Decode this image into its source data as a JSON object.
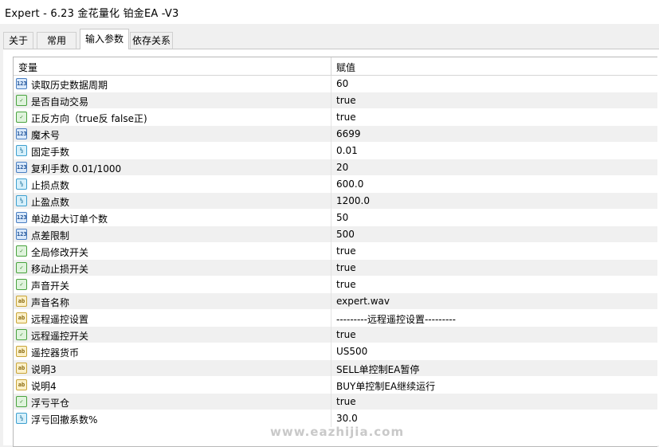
{
  "window": {
    "title": "Expert - 6.23  金花量化 铂金EA  -V3"
  },
  "tabs": [
    {
      "label": "关于"
    },
    {
      "label": "常用"
    },
    {
      "label": "输入参数"
    },
    {
      "label": "依存关系"
    }
  ],
  "table": {
    "header": {
      "variable": "变量",
      "value": "赋值"
    },
    "rows": [
      {
        "type": "int-icon",
        "icon_text": "123",
        "name": "读取历史数据周期",
        "value": "60"
      },
      {
        "type": "bool-icon",
        "icon_text": "✓",
        "name": "是否自动交易",
        "value": "true"
      },
      {
        "type": "bool-icon",
        "icon_text": "✓",
        "name": "正反方向（true反 false正)",
        "value": "true"
      },
      {
        "type": "int-icon",
        "icon_text": "123",
        "name": "魔术号",
        "value": "6699"
      },
      {
        "type": "double-icon",
        "icon_text": "½",
        "name": "固定手数",
        "value": "0.01"
      },
      {
        "type": "int-icon",
        "icon_text": "123",
        "name": "复利手数 0.01/1000",
        "value": "20"
      },
      {
        "type": "double-icon",
        "icon_text": "½",
        "name": "止损点数",
        "value": "600.0"
      },
      {
        "type": "double-icon",
        "icon_text": "½",
        "name": "止盈点数",
        "value": "1200.0"
      },
      {
        "type": "int-icon",
        "icon_text": "123",
        "name": "单边最大订单个数",
        "value": "50"
      },
      {
        "type": "int-icon",
        "icon_text": "123",
        "name": "点差限制",
        "value": "500"
      },
      {
        "type": "bool-icon",
        "icon_text": "✓",
        "name": "全局修改开关",
        "value": "true"
      },
      {
        "type": "bool-icon",
        "icon_text": "✓",
        "name": "移动止损开关",
        "value": "true"
      },
      {
        "type": "bool-icon",
        "icon_text": "✓",
        "name": "声音开关",
        "value": "true"
      },
      {
        "type": "string-icon",
        "icon_text": "ab",
        "name": "声音名称",
        "value": "expert.wav"
      },
      {
        "type": "string-icon",
        "icon_text": "ab",
        "name": "远程遥控设置",
        "value": "---------远程遥控设置---------"
      },
      {
        "type": "bool-icon",
        "icon_text": "✓",
        "name": "远程遥控开关",
        "value": "true"
      },
      {
        "type": "string-icon",
        "icon_text": "ab",
        "name": "遥控器货币",
        "value": "US500"
      },
      {
        "type": "string-icon",
        "icon_text": "ab",
        "name": "说明3",
        "value": "SELL单控制EA暂停"
      },
      {
        "type": "string-icon",
        "icon_text": "ab",
        "name": "说明4",
        "value": "BUY单控制EA继续运行"
      },
      {
        "type": "bool-icon",
        "icon_text": "✓",
        "name": "浮亏平仓",
        "value": "true"
      },
      {
        "type": "double-icon",
        "icon_text": "½",
        "name": "浮亏回撤系数%",
        "value": "30.0"
      }
    ]
  },
  "watermark": "www.eazhijia.com"
}
